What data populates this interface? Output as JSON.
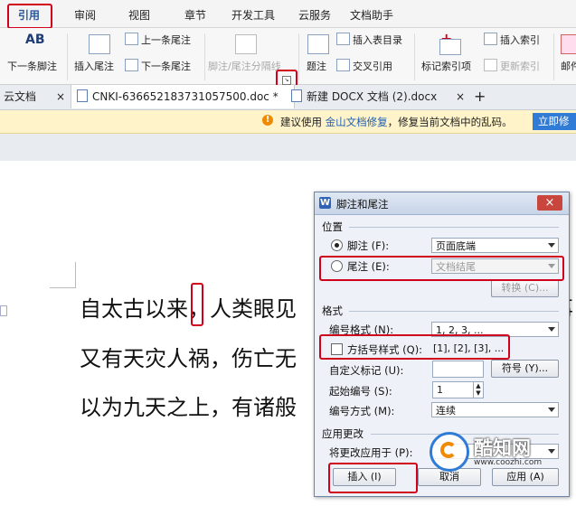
{
  "ribbon_tabs": [
    "引用",
    "审阅",
    "视图",
    "章节",
    "开发工具",
    "云服务",
    "文档助手"
  ],
  "ribbon": {
    "next_footnote": "下一条脚注",
    "ab_icon_text": "AB",
    "insert_endnote": "插入尾注",
    "prev_endnote": "上一条尾注",
    "next_endnote": "下一条尾注",
    "separator": "脚注/尾注分隔线",
    "caption": "题注",
    "insert_toc": "插入表目录",
    "cross_ref": "交叉引用",
    "mark_index": "标记索引项",
    "insert_index": "插入索引",
    "update_index": "更新索引",
    "mail": "邮件"
  },
  "doc_tabs": {
    "cloud": "云文档",
    "active": "CNKI-636652183731057500.doc *",
    "other": "新建 DOCX 文档 (2).docx",
    "close": "×",
    "add": "+"
  },
  "notification": {
    "pre": "建议使用",
    "link": "金山文档修复",
    "post": "，修复当前文档中的乱码。",
    "button": "立即修"
  },
  "document": {
    "line1a": "自太古以来",
    "line1b": "，人类眼见",
    "line1c": "事",
    "line2a": "又有天灾人祸，伤亡无",
    "line3a": "以为九天之上，有诸般"
  },
  "dialog": {
    "title": "脚注和尾注",
    "close": "×",
    "position_group": "位置",
    "footnote": "脚注 (F):",
    "footnote_value": "页面底端",
    "endnote": "尾注 (E):",
    "endnote_value": "文档结尾",
    "convert": "转换 (C)...",
    "format_group": "格式",
    "number_format": "编号格式 (N):",
    "number_format_value": "1, 2, 3, ...",
    "bracket_style": "方括号样式 (Q):",
    "bracket_value": "[1], [2], [3], ...",
    "custom_mark": "自定义标记 (U):",
    "symbol": "符号 (Y)...",
    "start_at": "起始编号 (S):",
    "start_value": "1",
    "numbering": "编号方式 (M):",
    "numbering_value": "连续",
    "apply_group": "应用更改",
    "apply_to": "将更改应用于 (P):",
    "insert": "插入 (I)",
    "cancel": "取消",
    "apply": "应用 (A)"
  },
  "watermark": {
    "name": "酷知网",
    "url": "www.coozhi.com"
  },
  "colors": {
    "highlight": "#d0021b",
    "accent": "#2b579a"
  }
}
